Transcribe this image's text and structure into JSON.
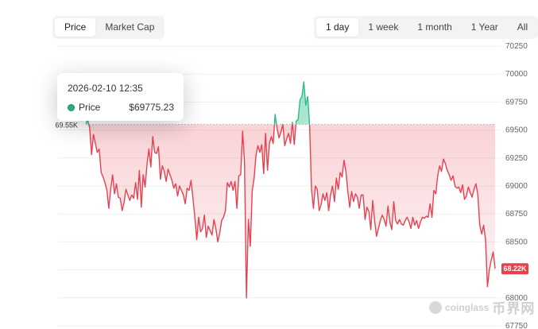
{
  "tabs_left": [
    {
      "label": "Price",
      "active": true
    },
    {
      "label": "Market Cap",
      "active": false
    }
  ],
  "tabs_right": [
    {
      "label": "1 day",
      "active": true
    },
    {
      "label": "1 week",
      "active": false
    },
    {
      "label": "1 month",
      "active": false
    },
    {
      "label": "1 Year",
      "active": false
    },
    {
      "label": "All",
      "active": false
    }
  ],
  "tooltip": {
    "time": "2026-02-10 12:35",
    "series": "Price",
    "value": "$69775.23"
  },
  "watermark": {
    "text": "coinglass",
    "cn_text": "币界网"
  },
  "colors": {
    "up": "#2ebd85",
    "down": "#e8404f",
    "grid": "#efefef",
    "tooltip_dot": "#26b27a"
  },
  "chart_data": {
    "type": "area",
    "y_ticks": [
      "70250",
      "70000",
      "69750",
      "69500",
      "69250",
      "69000",
      "68750",
      "68500",
      "68250",
      "68000",
      "67750"
    ],
    "ylim": [
      67750,
      70250
    ],
    "baseline": 69550,
    "baseline_label": "69.55K",
    "last_price_label": "68.22K",
    "grid": true,
    "series": [
      {
        "values": [
          69560,
          69590,
          69520,
          69280,
          69460,
          69380,
          69300,
          69330,
          69120,
          69080,
          69030,
          68960,
          68800,
          68970,
          69100,
          68930,
          69020,
          68900,
          68890,
          68780,
          68850,
          68970,
          68920,
          68870,
          68920,
          68890,
          69030,
          68880,
          69140,
          68810,
          69100,
          68990,
          69190,
          69330,
          69170,
          69440,
          69300,
          69290,
          69350,
          69060,
          69180,
          69130,
          69040,
          69150,
          69100,
          69050,
          68980,
          69020,
          68910,
          69000,
          68960,
          68920,
          68840,
          68980,
          68960,
          69050,
          68890,
          68720,
          68520,
          68720,
          68590,
          68620,
          68740,
          68540,
          68640,
          68600,
          68560,
          68700,
          68620,
          68500,
          68580,
          68690,
          68720,
          68780,
          69030,
          68990,
          69040,
          68960,
          69040,
          68800,
          69090,
          69100,
          69490,
          69210,
          68000,
          68700,
          68460,
          68960,
          69070,
          69280,
          69360,
          69300,
          69370,
          69110,
          69470,
          69140,
          69380,
          69440,
          69380,
          69640,
          69510,
          69430,
          69480,
          69550,
          69360,
          69420,
          69470,
          69380,
          69570,
          69370,
          69580,
          69590,
          69770,
          69800,
          69930,
          69720,
          69800,
          69540,
          68970,
          68800,
          69000,
          68970,
          68780,
          68830,
          68930,
          68870,
          68940,
          68780,
          68920,
          69000,
          68860,
          69070,
          68970,
          69120,
          69080,
          69230,
          69130,
          68950,
          68810,
          68950,
          68860,
          68930,
          68900,
          68800,
          68920,
          68920,
          68700,
          68810,
          68770,
          68610,
          68870,
          68690,
          68550,
          68620,
          68690,
          68740,
          68700,
          68640,
          68820,
          68680,
          68610,
          68860,
          68690,
          68660,
          68700,
          68660,
          68650,
          68690,
          68720,
          68680,
          68620,
          68720,
          68650,
          68690,
          68620,
          68680,
          68720,
          68710,
          68730,
          68720,
          68840,
          68720,
          68960,
          68930,
          69090,
          69180,
          69130,
          69240,
          69200,
          69140,
          69100,
          69050,
          69090,
          69000,
          68980,
          68990,
          68940,
          69010,
          68880,
          68910,
          68990,
          68940,
          68900,
          68970,
          69020,
          68920,
          68650,
          68570,
          68650,
          68520,
          68100,
          68250,
          68340,
          68410,
          68260
        ]
      }
    ]
  }
}
